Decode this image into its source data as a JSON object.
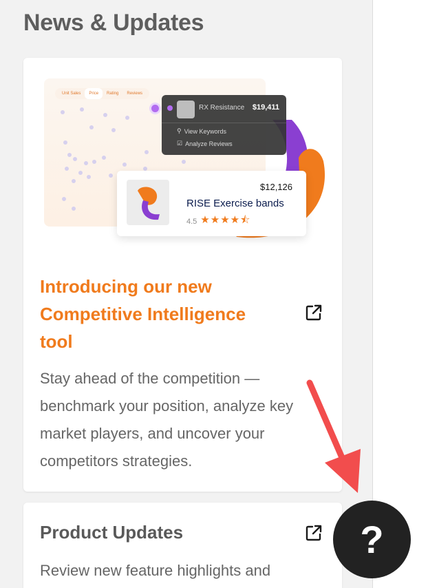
{
  "page": {
    "title": "News & Updates"
  },
  "hero": {
    "tabs": [
      "Unit Sales",
      "Price",
      "Rating",
      "Reviews"
    ],
    "active_tab": "Price",
    "dark_popover": {
      "product": "RX Resistance",
      "price": "$19,411",
      "links": [
        "View Keywords",
        "Analyze Reviews"
      ]
    },
    "product_card": {
      "price": "$12,126",
      "name": "RISE Exercise bands",
      "rating": "4.5",
      "stars": 4.5
    }
  },
  "cards": [
    {
      "title": "Introducing our new Competitive Intelligence tool",
      "description": "Stay ahead of the competition — benchmark your position, analyze key market players, and uncover your competitors strategies."
    },
    {
      "title": "Product Updates",
      "description": "Review new feature highlights and"
    }
  ],
  "help": {
    "label": "?"
  },
  "colors": {
    "accent": "#f07b1d",
    "annotation_arrow": "#f24d4d",
    "help_bg": "#222222"
  }
}
